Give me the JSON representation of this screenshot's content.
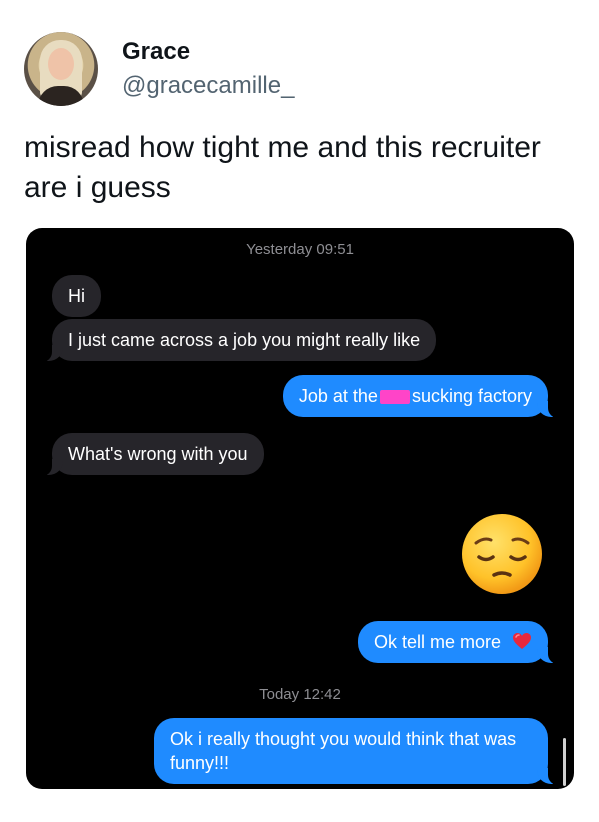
{
  "profile": {
    "name": "Grace",
    "handle": "@gracecamille_"
  },
  "tweet": {
    "text": "misread how tight me and this recruiter are i guess"
  },
  "chat": {
    "timestamp_1": "Yesterday 09:51",
    "msg_hi": "Hi",
    "msg_job": "I just came across a job you might really like",
    "msg_reply_before": "Job at the",
    "msg_reply_after": "sucking factory",
    "msg_wrong": "What's wrong with you",
    "emoji": "pensive-face",
    "msg_tell_more": "Ok tell me more",
    "heart": "red-heart",
    "timestamp_2": "Today 12:42",
    "msg_funny": "Ok i really thought you would think that was funny!!!"
  },
  "colors": {
    "incoming_bubble": "#26252a",
    "outgoing_bubble": "#1f8bff",
    "chat_background": "#000000",
    "censor_mark": "#ff44c8"
  }
}
